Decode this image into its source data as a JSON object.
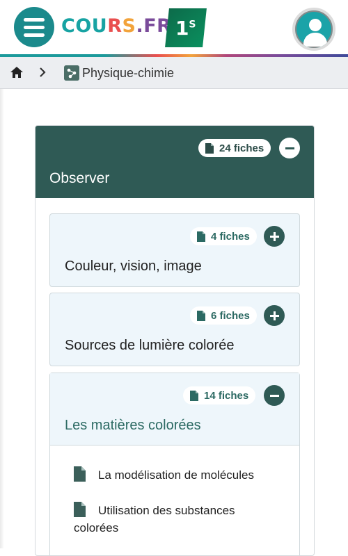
{
  "header": {
    "logo_text": [
      "COU",
      "R",
      "S",
      ".",
      "F",
      "R"
    ],
    "level": "1",
    "level_sup": "S",
    "colors": {
      "brand_teal": "#1b8a8c",
      "card_header": "#2f5a55",
      "subcard_bg": "#eef6fb"
    }
  },
  "breadcrumb": {
    "home_icon": "home-icon",
    "separator_icon": "chevron-right-icon",
    "subject_label": "Physique-chimie"
  },
  "section": {
    "title": "Observer",
    "count_label": "24 fiches",
    "expanded": true,
    "subsections": [
      {
        "title": "Couleur, vision, image",
        "count_label": "4 fiches",
        "expanded": false
      },
      {
        "title": "Sources de lumière colorée",
        "count_label": "6 fiches",
        "expanded": false
      },
      {
        "title": "Les matières colorées",
        "count_label": "14 fiches",
        "expanded": true,
        "items": [
          {
            "label": "La modélisation de molécules"
          },
          {
            "label": "Utilisation des substances colorées"
          }
        ]
      }
    ]
  }
}
